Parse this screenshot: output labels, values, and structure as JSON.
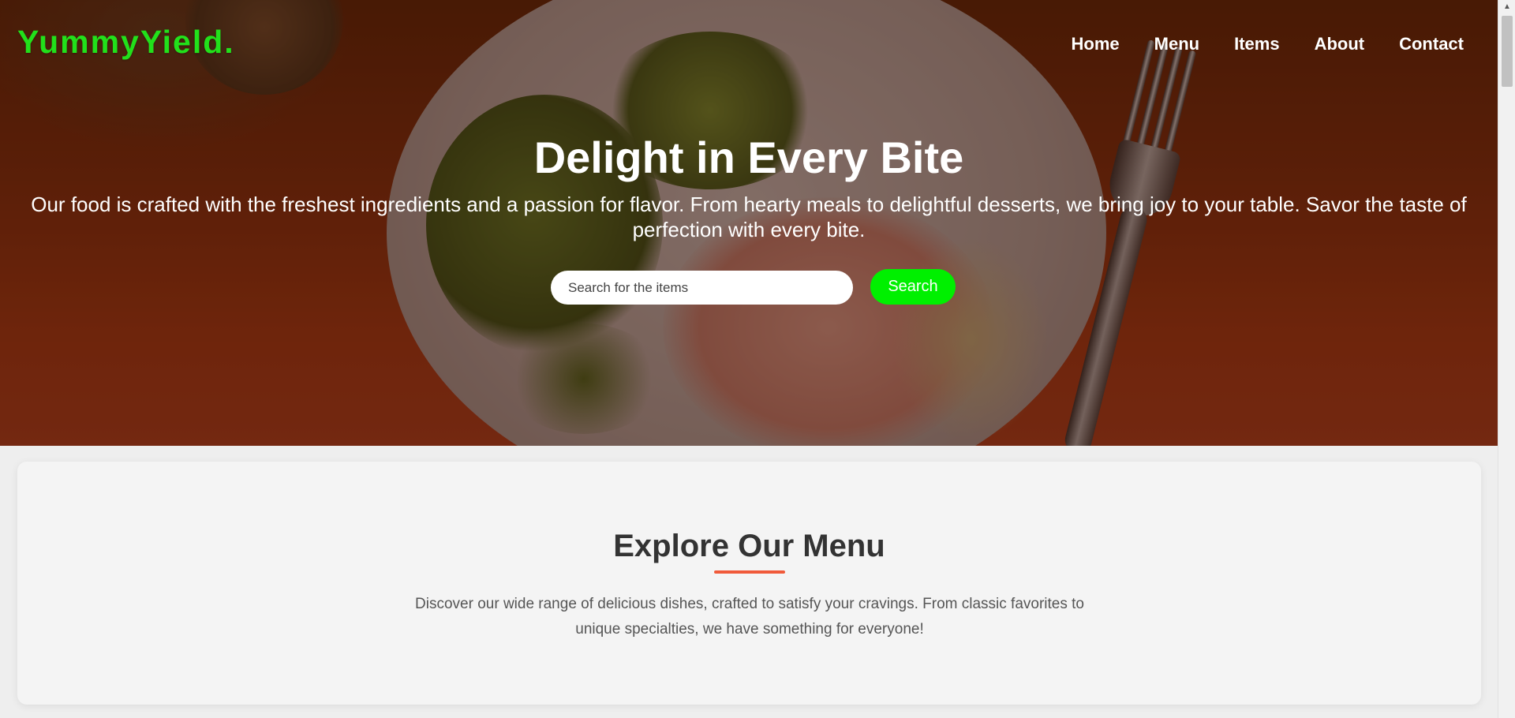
{
  "brand": {
    "logo": "YummyYield.",
    "logo_color": "#22e01b"
  },
  "nav": {
    "items": [
      {
        "label": "Home"
      },
      {
        "label": "Menu"
      },
      {
        "label": "Items"
      },
      {
        "label": "About"
      },
      {
        "label": "Contact"
      }
    ]
  },
  "hero": {
    "title": "Delight in Every Bite",
    "text": "Our food is crafted with the freshest ingredients and a passion for flavor. From hearty meals to delightful desserts, we bring joy to your table. Savor the taste of perfection with every bite.",
    "search": {
      "placeholder": "Search for the items",
      "value": "",
      "button_label": "Search",
      "button_color": "#00f000"
    }
  },
  "menu_section": {
    "title": "Explore Our Menu",
    "text": "Discover our wide range of delicious dishes, crafted to satisfy your cravings. From classic favorites to unique specialties, we have something for everyone!",
    "accent_color": "#f05a3a"
  },
  "scrollbar": {
    "up_icon": "▲"
  }
}
